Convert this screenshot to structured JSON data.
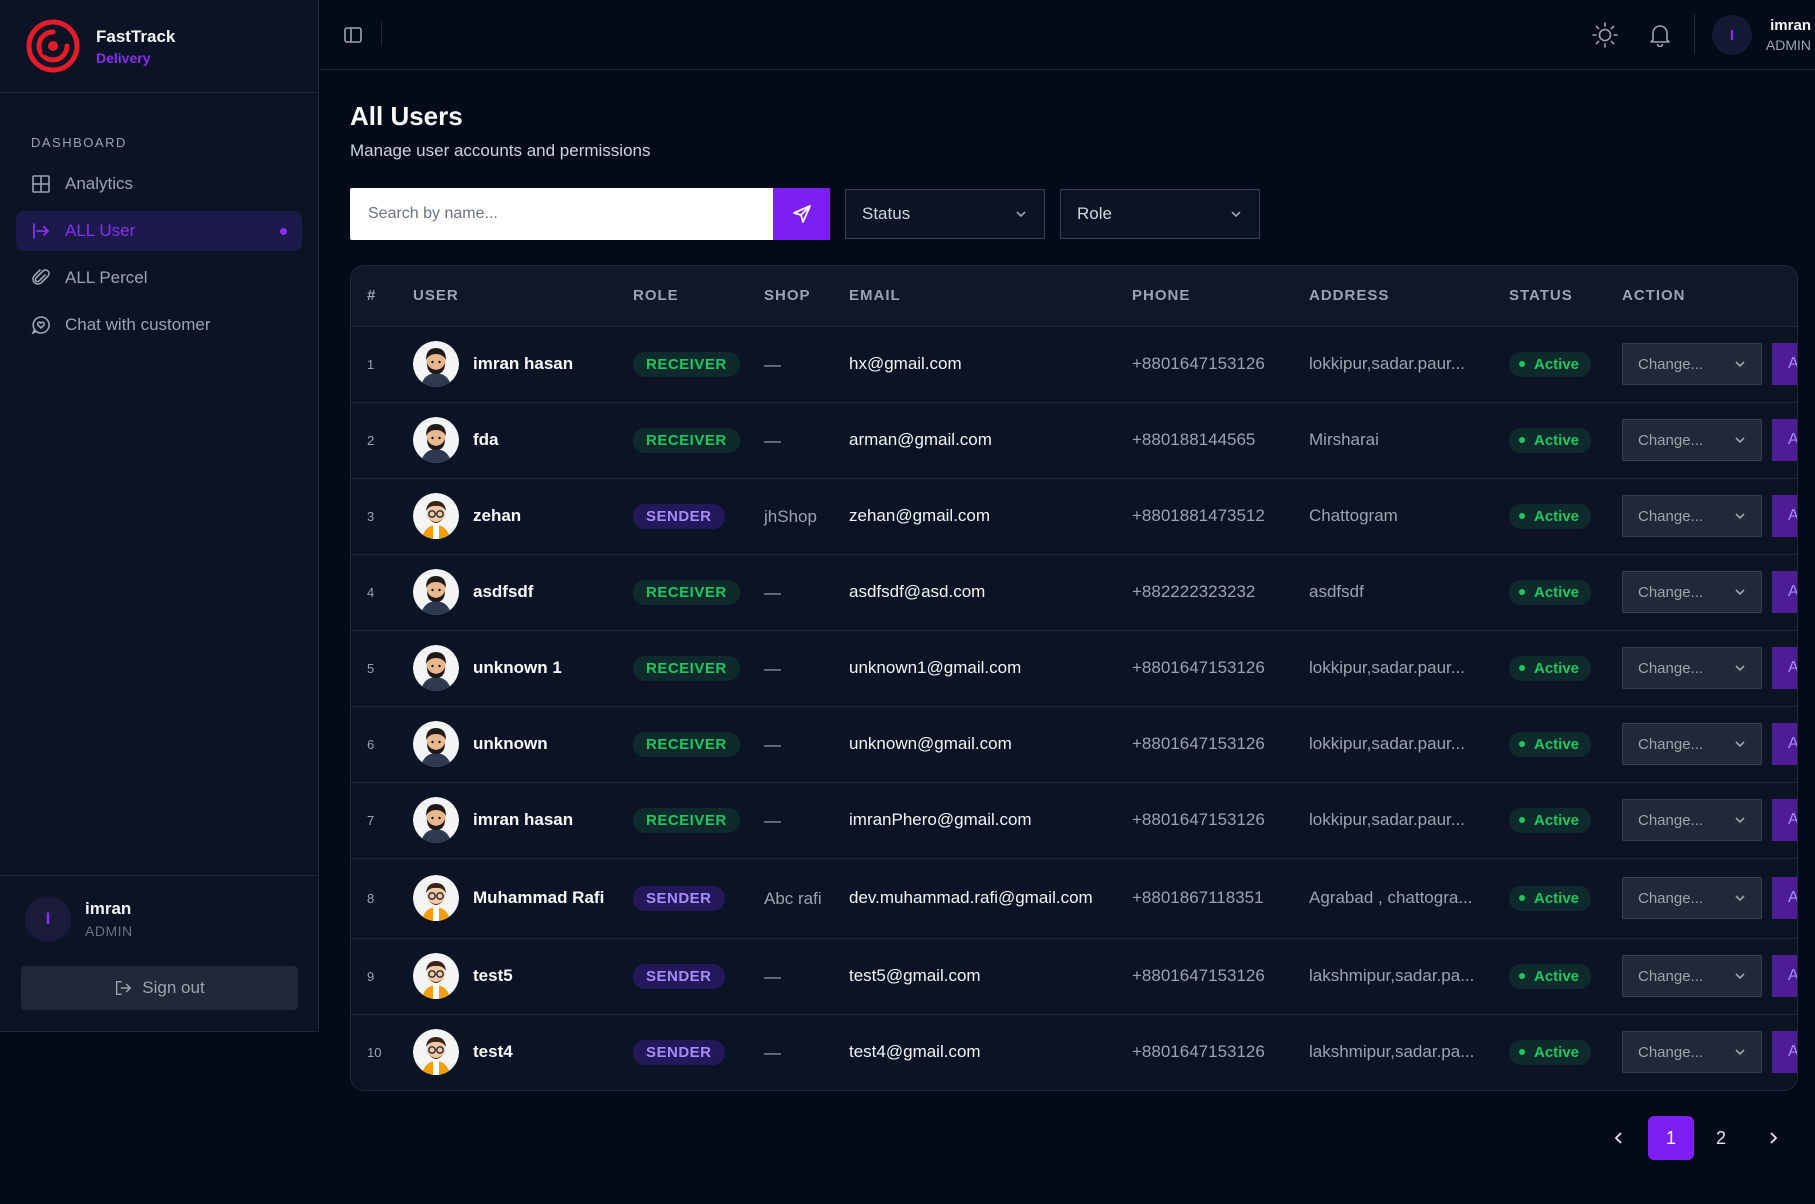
{
  "brand": {
    "name": "FastTrack",
    "sub": "Delivery"
  },
  "sidebar": {
    "section": "DASHBOARD",
    "items": [
      {
        "label": "Analytics",
        "icon": "grid-icon"
      },
      {
        "label": "ALL User",
        "icon": "arrow-right-bar-icon"
      },
      {
        "label": "ALL Percel",
        "icon": "paperclip-icon"
      },
      {
        "label": "Chat with customer",
        "icon": "chat-heart-icon"
      }
    ],
    "user": {
      "initial": "I",
      "name": "imran",
      "role": "ADMIN"
    },
    "signout": "Sign out"
  },
  "topbar": {
    "avatar_initial": "I",
    "name": "imran",
    "role": "ADMIN"
  },
  "page": {
    "title": "All Users",
    "subtitle": "Manage user accounts and permissions"
  },
  "filters": {
    "search_placeholder": "Search by name...",
    "status": "Status",
    "role": "Role"
  },
  "table": {
    "headers": [
      "#",
      "USER",
      "ROLE",
      "SHOP",
      "EMAIL",
      "PHONE",
      "ADDRESS",
      "STATUS",
      "ACTION"
    ],
    "change_label": "Change...",
    "apply_label": "A",
    "rows": [
      {
        "num": "1",
        "name": "imran hasan",
        "role": "RECEIVER",
        "shop": "—",
        "email": "hx@gmail.com",
        "phone": "+8801647153126",
        "address": "lokkipur,sadar.paur...",
        "status": "Active",
        "avatar": "male"
      },
      {
        "num": "2",
        "name": "fda",
        "role": "RECEIVER",
        "shop": "—",
        "email": "arman@gmail.com",
        "phone": "+880188144565",
        "address": "Mirsharai",
        "status": "Active",
        "avatar": "male"
      },
      {
        "num": "3",
        "name": "zehan",
        "role": "SENDER",
        "shop": "jhShop",
        "email": "zehan@gmail.com",
        "phone": "+8801881473512",
        "address": "Chattogram",
        "status": "Active",
        "avatar": "glasses"
      },
      {
        "num": "4",
        "name": "asdfsdf",
        "role": "RECEIVER",
        "shop": "—",
        "email": "asdfsdf@asd.com",
        "phone": "+882222323232",
        "address": "asdfsdf",
        "status": "Active",
        "avatar": "male"
      },
      {
        "num": "5",
        "name": "unknown 1",
        "role": "RECEIVER",
        "shop": "—",
        "email": "unknown1@gmail.com",
        "phone": "+8801647153126",
        "address": "lokkipur,sadar.paur...",
        "status": "Active",
        "avatar": "male"
      },
      {
        "num": "6",
        "name": "unknown",
        "role": "RECEIVER",
        "shop": "—",
        "email": "unknown@gmail.com",
        "phone": "+8801647153126",
        "address": "lokkipur,sadar.paur...",
        "status": "Active",
        "avatar": "male"
      },
      {
        "num": "7",
        "name": "imran hasan",
        "role": "RECEIVER",
        "shop": "—",
        "email": "imranPhero@gmail.com",
        "phone": "+8801647153126",
        "address": "lokkipur,sadar.paur...",
        "status": "Active",
        "avatar": "male"
      },
      {
        "num": "8",
        "name": "Muhammad Rafi",
        "role": "SENDER",
        "shop": "Abc rafi",
        "email": "dev.muhammad.rafi@gmail.com",
        "phone": "+8801867118351",
        "address": "Agrabad , chattogra...",
        "status": "Active",
        "avatar": "glasses"
      },
      {
        "num": "9",
        "name": "test5",
        "role": "SENDER",
        "shop": "—",
        "email": "test5@gmail.com",
        "phone": "+8801647153126",
        "address": "lakshmipur,sadar.pa...",
        "status": "Active",
        "avatar": "glasses"
      },
      {
        "num": "10",
        "name": "test4",
        "role": "SENDER",
        "shop": "—",
        "email": "test4@gmail.com",
        "phone": "+8801647153126",
        "address": "lakshmipur,sadar.pa...",
        "status": "Active",
        "avatar": "glasses"
      }
    ]
  },
  "pagination": {
    "pages": [
      "1",
      "2"
    ],
    "current": "1"
  },
  "colors": {
    "accent": "#7c1ff0",
    "success": "#22c55e",
    "background": "#050a18",
    "panel": "#0b1324"
  }
}
